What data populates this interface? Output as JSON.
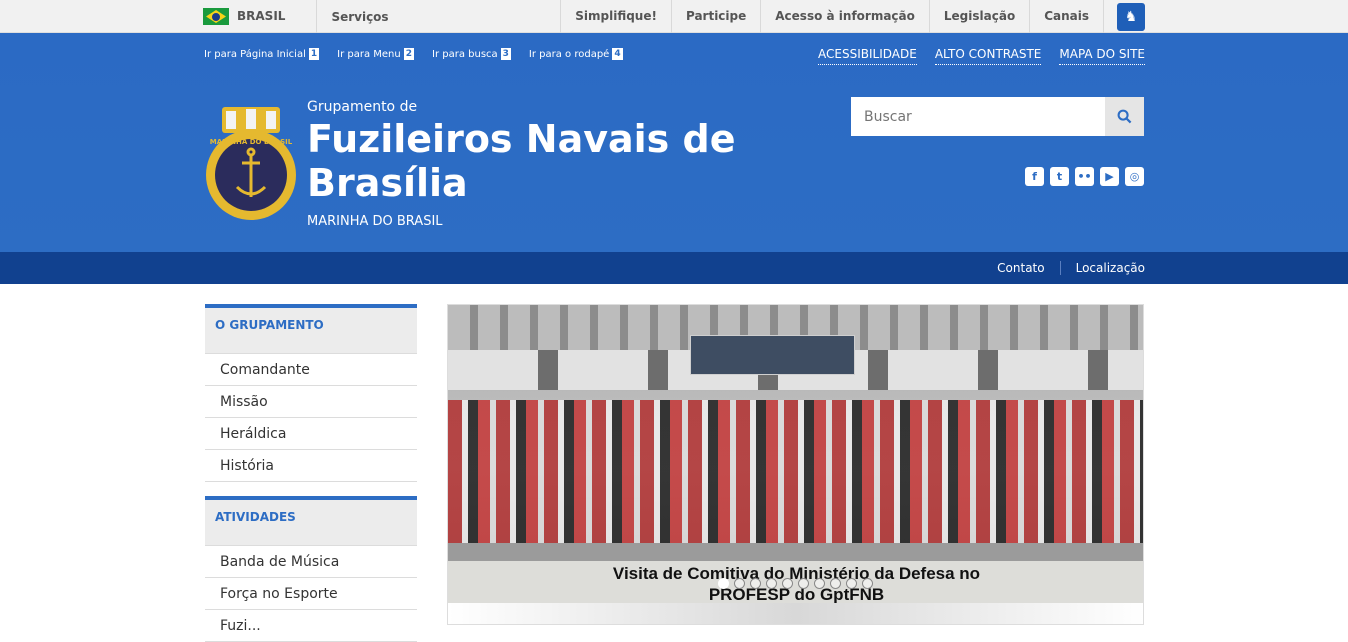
{
  "govbar": {
    "country": "BRASIL",
    "services": "Serviços",
    "links": [
      "Simplifique!",
      "Participe",
      "Acesso à informação",
      "Legislação",
      "Canais"
    ]
  },
  "skip_links": [
    {
      "label": "Ir para Página Inicial",
      "num": "1"
    },
    {
      "label": "Ir para Menu",
      "num": "2"
    },
    {
      "label": "Ir para busca",
      "num": "3"
    },
    {
      "label": "Ir para o rodapé",
      "num": "4"
    }
  ],
  "accessibility": [
    "ACESSIBILIDADE",
    "ALTO CONTRASTE",
    "MAPA DO SITE"
  ],
  "site": {
    "subtitle": "Grupamento de",
    "title": "Fuzileiros Navais de Brasília",
    "org": "MARINHA DO BRASIL",
    "logo_text": "MARINHA DO BRASIL"
  },
  "search": {
    "placeholder": "Buscar"
  },
  "social": [
    "facebook-icon",
    "twitter-icon",
    "flickr-icon",
    "youtube-icon",
    "instagram-icon"
  ],
  "subnav": [
    "Contato",
    "Localização"
  ],
  "sidebar": {
    "sections": [
      {
        "title": "O GRUPAMENTO",
        "items": [
          "Comandante",
          "Missão",
          "Heráldica",
          "História"
        ]
      },
      {
        "title": "ATIVIDADES",
        "items": [
          "Banda de Música",
          "Força no Esporte",
          "Fuzi..."
        ]
      }
    ]
  },
  "carousel": {
    "caption_line1": "Visita de Comitiva do Ministério da Defesa no",
    "caption_line2": "PROFESP do GptFNB",
    "slides": 10,
    "active": 1
  },
  "colors": {
    "brand_blue": "#2d6dc4",
    "nav_dark": "#11418f",
    "bar_gray": "#f1f1f1"
  }
}
